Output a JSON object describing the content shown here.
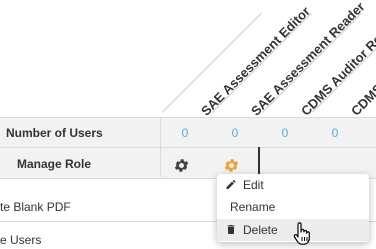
{
  "columns": [
    {
      "label": "SAE Assessment Editor",
      "user_count": "0"
    },
    {
      "label": "SAE Assessment Reader",
      "user_count": "0"
    },
    {
      "label": "CDMS Auditor Read So",
      "user_count": "0"
    },
    {
      "label": "CDMS C",
      "user_count": "0"
    }
  ],
  "rows": {
    "number_of_users": "Number of Users",
    "manage_role": "Manage Role",
    "permission_1": "te Blank PDF",
    "permission_2": "e Users"
  },
  "context_menu": {
    "items": [
      {
        "label": "Edit",
        "icon": "pencil-icon"
      },
      {
        "label": "Rename",
        "icon": ""
      },
      {
        "label": "Delete",
        "icon": "trash-icon"
      }
    ],
    "hovered": "Delete"
  },
  "colors": {
    "count_blue": "#5aaddf",
    "gear_active_orange": "#f0a030",
    "gear_default": "#444444",
    "header_row_bg": "#f2f2f2",
    "menu_hover_bg": "#ececec"
  },
  "icons": {
    "gear": "gear-icon",
    "cursor": "hand-pointer-icon"
  }
}
